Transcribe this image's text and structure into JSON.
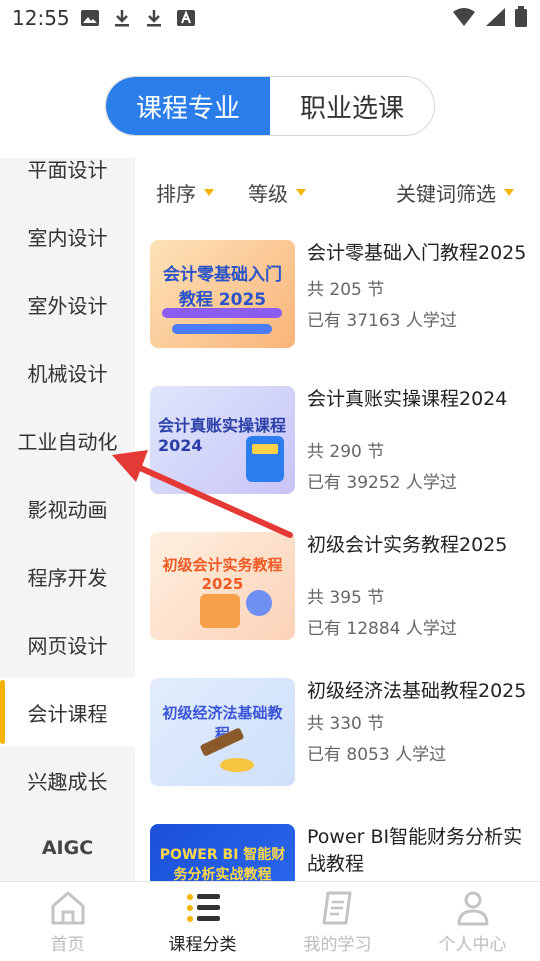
{
  "status_bar": {
    "time": "12:55",
    "left_icons": [
      "image-icon",
      "download-icon",
      "download-icon",
      "font-icon"
    ],
    "right_icons": [
      "wifi-icon",
      "signal-icon",
      "battery-icon"
    ]
  },
  "top_tabs": [
    {
      "label": "课程专业",
      "active": true
    },
    {
      "label": "职业选课",
      "active": false
    }
  ],
  "sidebar": {
    "items": [
      {
        "label": "平面设计"
      },
      {
        "label": "室内设计"
      },
      {
        "label": "室外设计"
      },
      {
        "label": "机械设计"
      },
      {
        "label": "工业自动化"
      },
      {
        "label": "影视动画"
      },
      {
        "label": "程序开发"
      },
      {
        "label": "网页设计"
      },
      {
        "label": "会计课程",
        "active": true
      },
      {
        "label": "兴趣成长"
      },
      {
        "label": "AIGC"
      }
    ]
  },
  "filters": {
    "sort": "排序",
    "level": "等级",
    "keyword": "关键词筛选"
  },
  "courses": [
    {
      "title": "会计零基础入门教程2025",
      "lessons": "共 205 节",
      "learned": "已有  37163 人学过",
      "thumb_caption": "会计零基础入门教程 2025"
    },
    {
      "title": "会计真账实操课程2024",
      "lessons": "共 290 节",
      "learned": "已有  39252 人学过",
      "thumb_caption": "会计真账实操课程2024"
    },
    {
      "title": "初级会计实务教程2025",
      "lessons": "共 395 节",
      "learned": "已有  12884 人学过",
      "thumb_caption": "初级会计实务教程 2025"
    },
    {
      "title": "初级经济法基础教程2025",
      "lessons": "共 330 节",
      "learned": "已有  8053 人学过",
      "thumb_caption": "初级经济法基础教程"
    },
    {
      "title": "Power BI智能财务分析实战教程",
      "lessons": "",
      "learned": "",
      "thumb_caption": "POWER BI 智能财务分析实战教程"
    }
  ],
  "bottom_nav": [
    {
      "label": "首页",
      "icon": "home-icon"
    },
    {
      "label": "课程分类",
      "icon": "list-icon",
      "active": true
    },
    {
      "label": "我的学习",
      "icon": "notebook-icon"
    },
    {
      "label": "个人中心",
      "icon": "person-icon"
    }
  ],
  "colors": {
    "accent": "#2b7de9",
    "highlight": "#f5b400",
    "arrow": "#e53935"
  }
}
